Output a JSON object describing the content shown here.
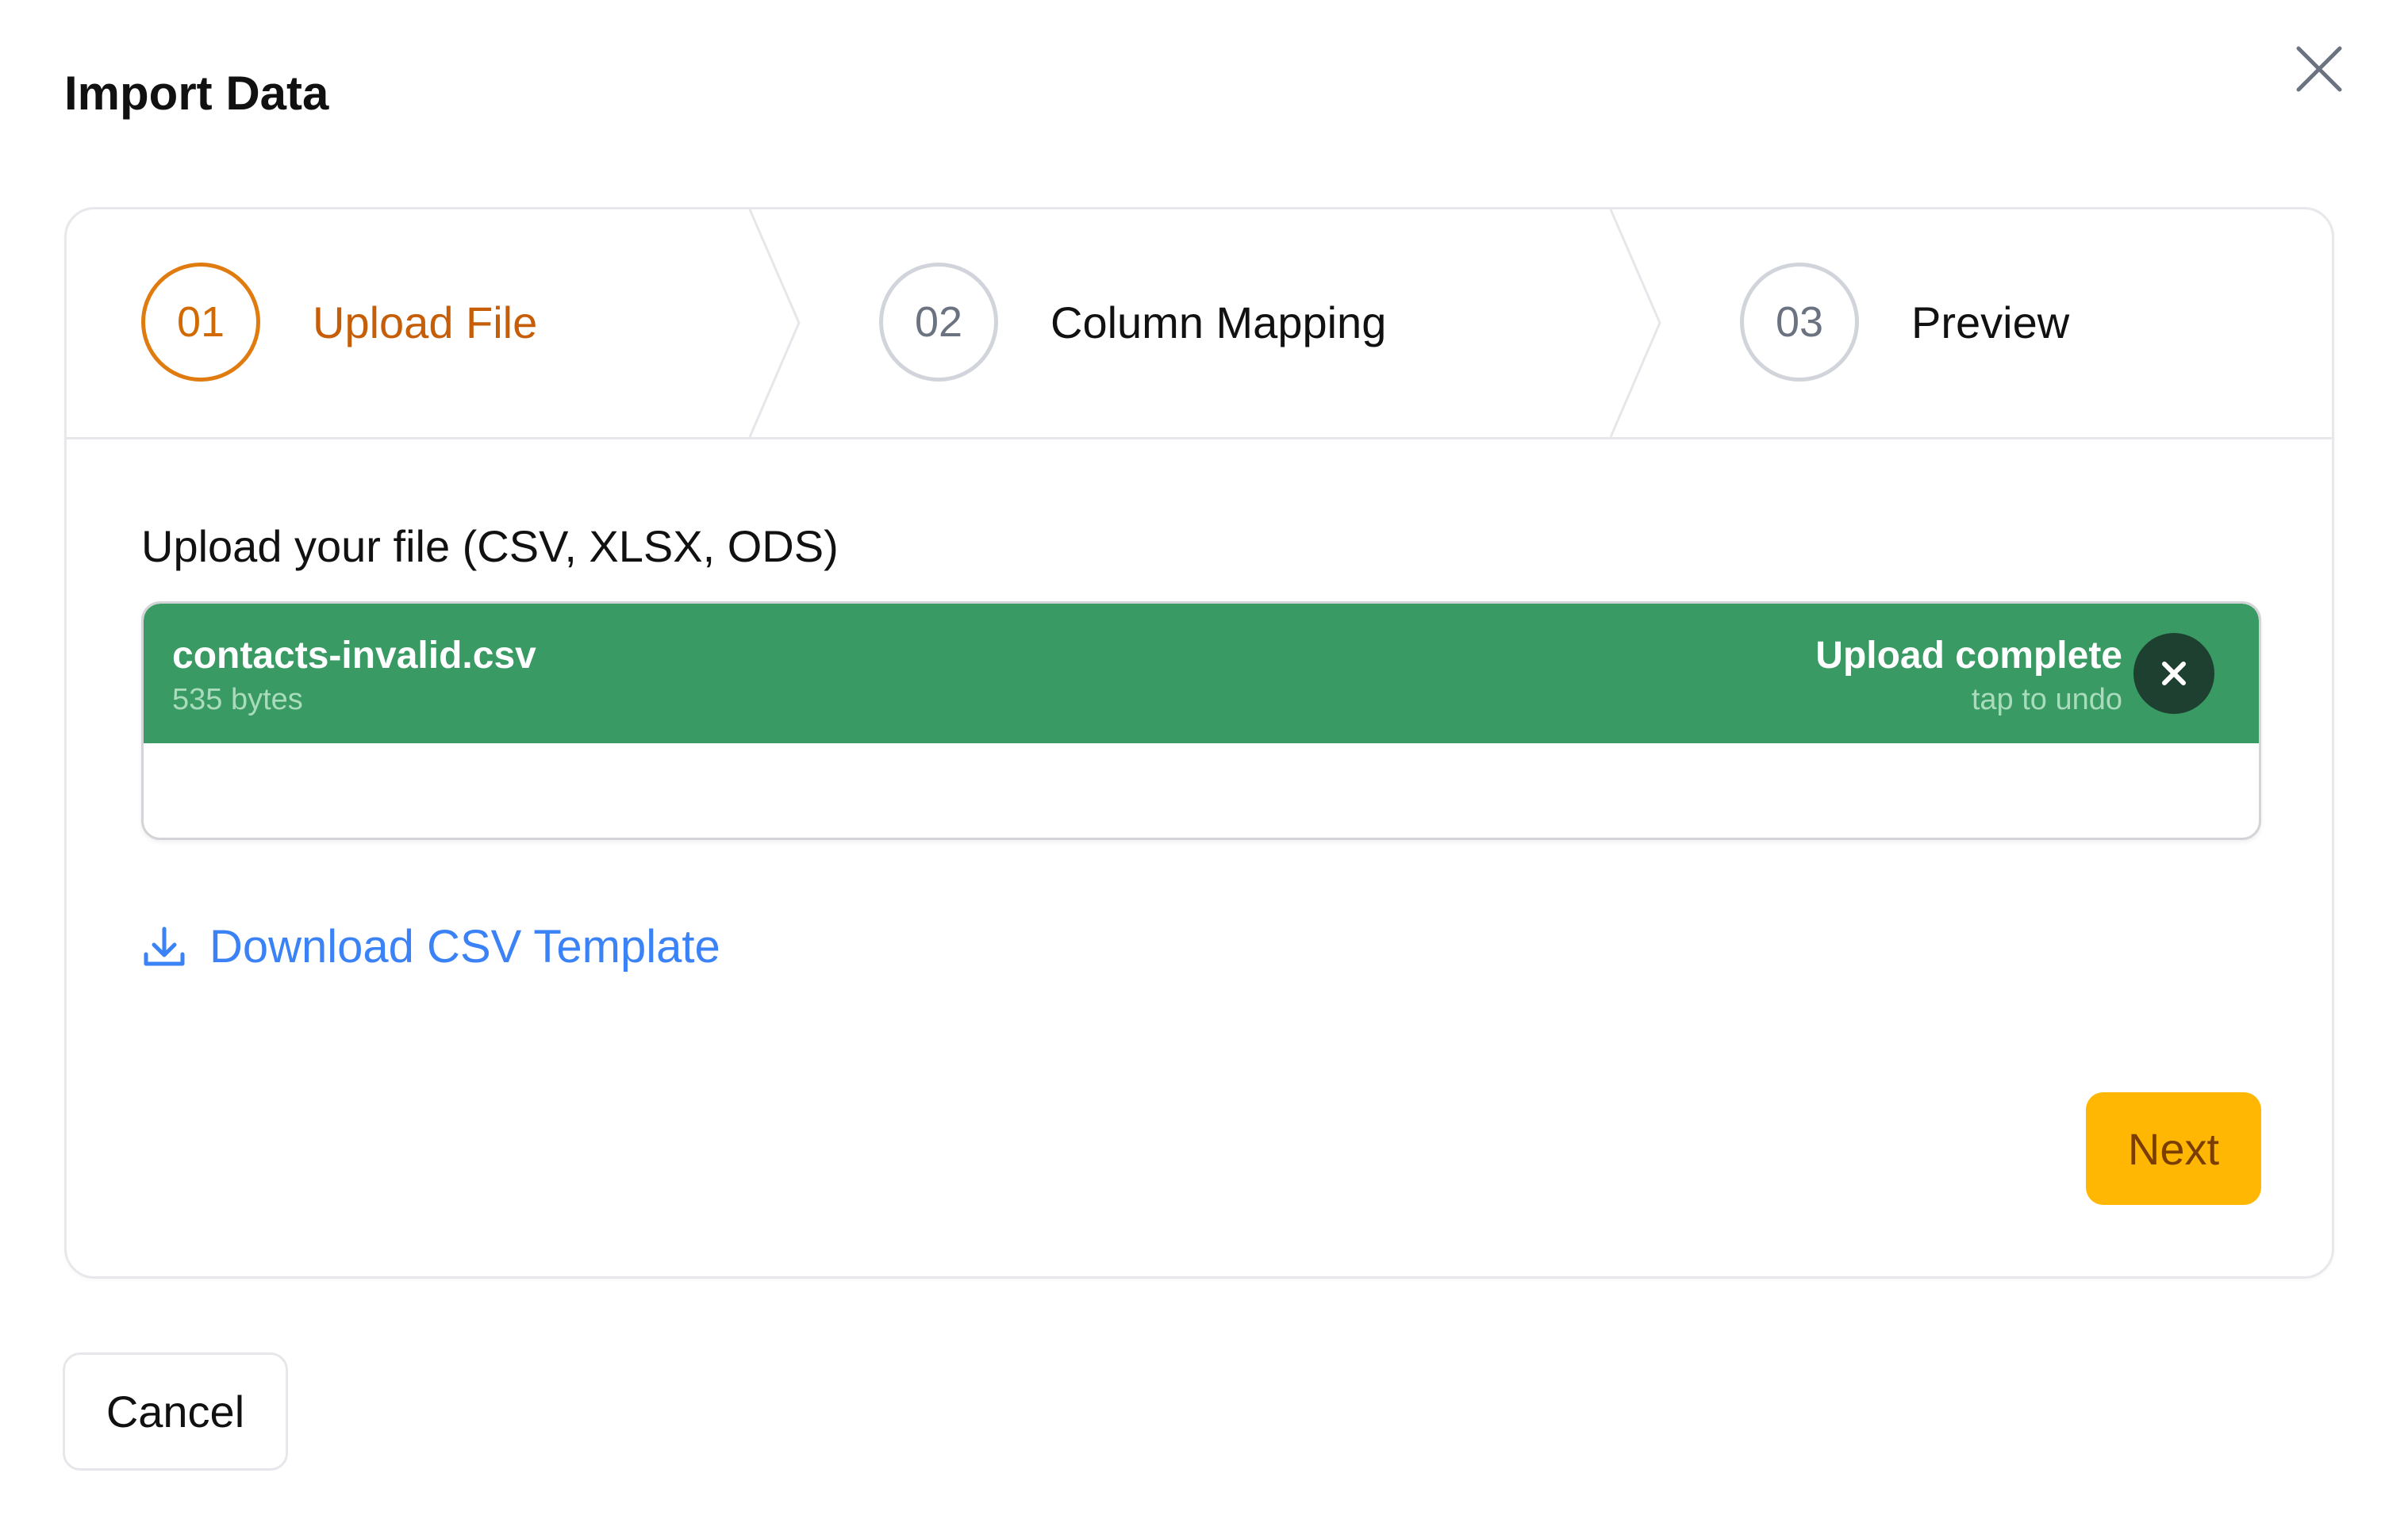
{
  "dialog": {
    "title": "Import Data",
    "close_icon": "close-icon"
  },
  "stepper": {
    "steps": [
      {
        "number": "01",
        "label": "Upload File",
        "active": true
      },
      {
        "number": "02",
        "label": "Column Mapping",
        "active": false
      },
      {
        "number": "03",
        "label": "Preview",
        "active": false
      }
    ],
    "active_color": "#e07b0f"
  },
  "upload": {
    "label": "Upload your file (CSV, XLSX, ODS)",
    "file": {
      "name": "contacts-invalid.csv",
      "size": "535 bytes",
      "status": "Upload complete",
      "undo_hint": "tap to undo",
      "remove_icon": "close-icon",
      "color": "#3a9a63"
    }
  },
  "download": {
    "label": "Download CSV Template",
    "icon": "download-icon"
  },
  "actions": {
    "next_label": "Next",
    "next_color": "#ffb703",
    "cancel_label": "Cancel"
  }
}
